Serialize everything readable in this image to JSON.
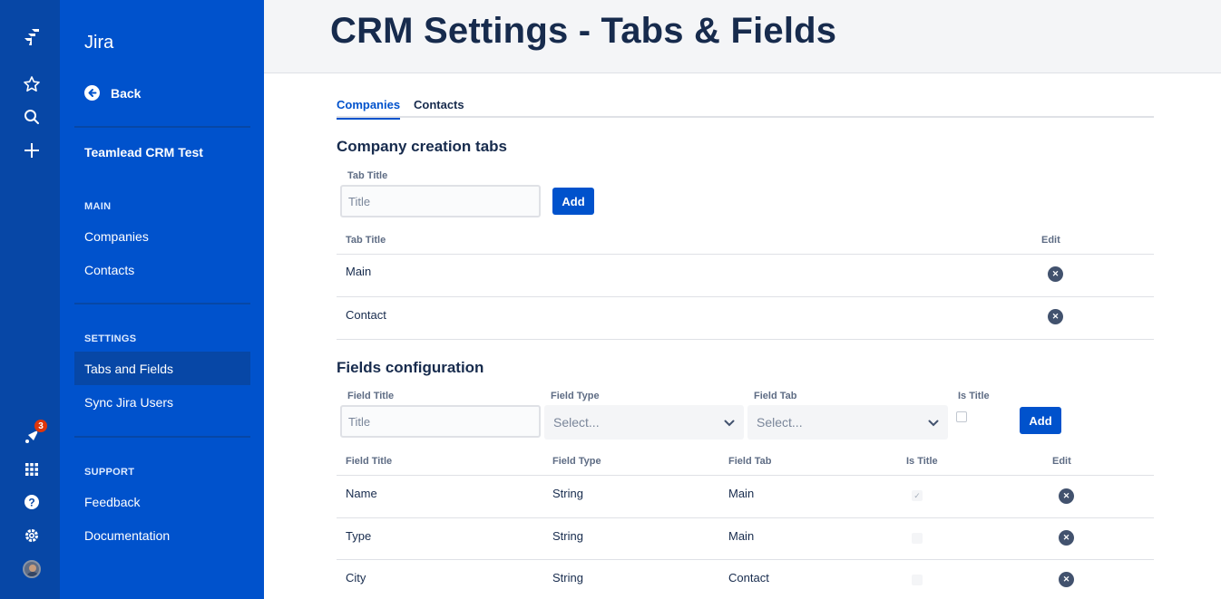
{
  "rail": {
    "notifications_count": "3",
    "icons": [
      "jira-logo-icon",
      "star-icon",
      "search-icon",
      "plus-icon",
      "notifications-icon",
      "app-switcher-icon",
      "help-icon",
      "settings-icon",
      "avatar"
    ]
  },
  "sidebar": {
    "product": "Jira",
    "back_label": "Back",
    "project_name": "Teamlead CRM Test",
    "main_heading": "MAIN",
    "main_items": [
      {
        "label": "Companies"
      },
      {
        "label": "Contacts"
      }
    ],
    "settings_heading": "SETTINGS",
    "settings_items": [
      {
        "label": "Tabs and Fields",
        "active": true
      },
      {
        "label": "Sync Jira Users"
      }
    ],
    "support_heading": "SUPPORT",
    "support_items": [
      {
        "label": "Feedback"
      },
      {
        "label": "Documentation"
      }
    ]
  },
  "header": {
    "title": "CRM Settings - Tabs & Fields"
  },
  "tabs": [
    {
      "label": "Companies",
      "active": true
    },
    {
      "label": "Contacts"
    }
  ],
  "tabs_section": {
    "title": "Company creation tabs",
    "input_label": "Tab Title",
    "input_placeholder": "Title",
    "add_label": "Add",
    "table_headers": {
      "title": "Tab Title",
      "edit": "Edit"
    },
    "rows": [
      {
        "title": "Main"
      },
      {
        "title": "Contact"
      }
    ]
  },
  "fields_section": {
    "title": "Fields configuration",
    "labels": {
      "field_title": "Field Title",
      "field_type": "Field Type",
      "field_tab": "Field Tab",
      "is_title": "Is Title"
    },
    "field_title_placeholder": "Title",
    "field_type_placeholder": "Select...",
    "field_tab_placeholder": "Select...",
    "add_label": "Add",
    "table_headers": {
      "field_title": "Field Title",
      "field_type": "Field Type",
      "field_tab": "Field Tab",
      "is_title": "Is Title",
      "edit": "Edit"
    },
    "rows": [
      {
        "title": "Name",
        "type": "String",
        "tab": "Main",
        "is_title": true
      },
      {
        "title": "Type",
        "type": "String",
        "tab": "Main",
        "is_title": false
      },
      {
        "title": "City",
        "type": "String",
        "tab": "Contact",
        "is_title": false
      }
    ]
  },
  "colors": {
    "rail": "#0747a6",
    "sidebar": "#0052cc",
    "primary": "#0052cc",
    "text": "#172b4d"
  }
}
